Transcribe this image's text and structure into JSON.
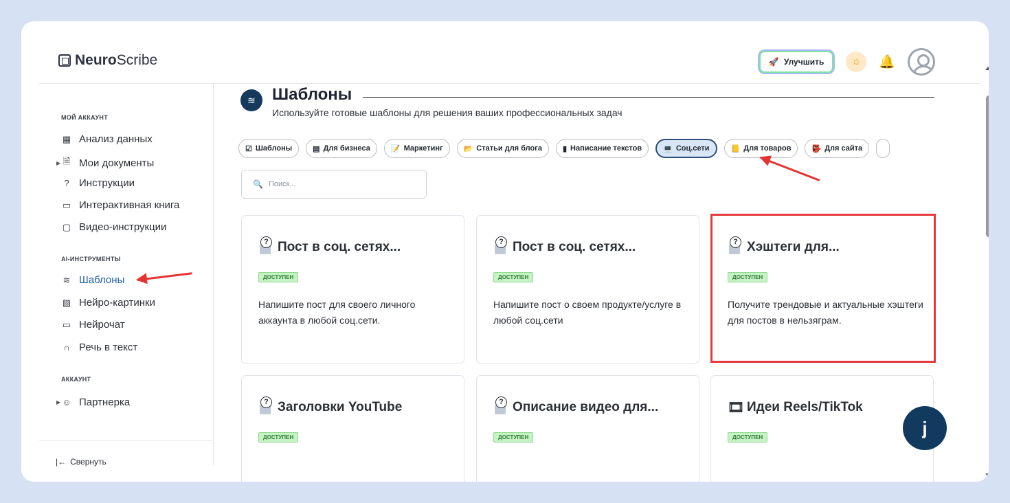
{
  "brand": {
    "bold": "Neuro",
    "light": "Scribe"
  },
  "header": {
    "upgrade_label": "Улучшить"
  },
  "sidebar": {
    "sections": [
      {
        "title": "МОЙ АККАУНТ"
      },
      {
        "title": "AI-ИНСТРУМЕНТЫ"
      },
      {
        "title": "АККАУНТ"
      }
    ],
    "items": [
      {
        "label": "Анализ данных"
      },
      {
        "label": "Мои документы"
      },
      {
        "label": "Инструкции"
      },
      {
        "label": "Интерактивная книга"
      },
      {
        "label": "Видео-инструкции"
      },
      {
        "label": "Шаблоны"
      },
      {
        "label": "Нейро-картинки"
      },
      {
        "label": "Нейрочат"
      },
      {
        "label": "Речь в текст"
      },
      {
        "label": "Партнерка"
      }
    ],
    "collapse_label": "Свернуть"
  },
  "page": {
    "title": "Шаблоны",
    "subtitle": "Используйте готовые шаблоны для решения ваших профессиональных задач"
  },
  "chips": [
    {
      "label": "Шаблоны"
    },
    {
      "label": "Для бизнеса"
    },
    {
      "label": "Маркетинг"
    },
    {
      "label": "Статьи для блога"
    },
    {
      "label": "Написание текстов"
    },
    {
      "label": "Соц.сети",
      "active": true
    },
    {
      "label": "Для товаров"
    },
    {
      "label": "Для сайта"
    }
  ],
  "search": {
    "placeholder": "Поиск..."
  },
  "cards": [
    {
      "title": "Пост в соц. сетях...",
      "badge": "ДОСТУПЕН",
      "desc": "Напишите пост для своего личного аккаунта в любой соц.сети."
    },
    {
      "title": "Пост в соц. сетях...",
      "badge": "ДОСТУПЕН",
      "desc": "Напишите пост о своем продукте/услуге в любой соц.сети"
    },
    {
      "title": "Хэштеги для...",
      "badge": "ДОСТУПЕН",
      "desc": "Получите трендовые и актуальные хэштеги для постов в нельзяграм."
    },
    {
      "title": "Заголовки YouTube",
      "badge": "ДОСТУПЕН",
      "desc": ""
    },
    {
      "title": "Описание видео для...",
      "badge": "ДОСТУПЕН",
      "desc": ""
    },
    {
      "title": "Идеи Reels/TikTok",
      "badge": "ДОСТУПЕН",
      "desc": ""
    }
  ],
  "colors": {
    "accent": "#153a5c",
    "highlight": "#e5393d",
    "badge_bg": "#c7f2c6"
  }
}
